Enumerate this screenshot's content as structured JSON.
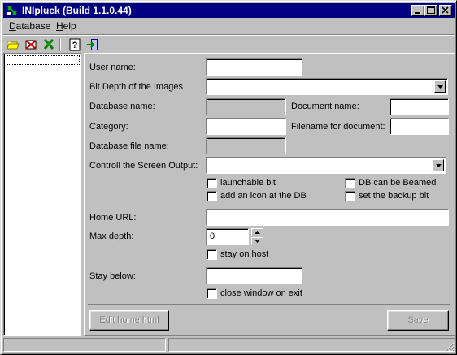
{
  "window": {
    "title": "INIpluck (Build 1.1.0.44)",
    "buttons": [
      "minimize-icon",
      "maximize-icon",
      "close-icon"
    ],
    "colors": {
      "titlebar": "#000080",
      "face": "#c0c0c0",
      "field": "#ffffff"
    }
  },
  "menu": {
    "items": [
      {
        "label": "Database",
        "mnemonic": "D",
        "rest": "atabase"
      },
      {
        "label": "Help",
        "mnemonic": "H",
        "rest": "elp"
      }
    ]
  },
  "toolbar": {
    "icons": [
      "open-folder-icon",
      "delete-database-icon",
      "pluck-icon",
      "help-icon",
      "exit-icon"
    ]
  },
  "form": {
    "user_name": {
      "label": "User name:",
      "value": ""
    },
    "bit_depth": {
      "label": "Bit Depth of the Images",
      "value": ""
    },
    "database_name": {
      "label": "Database name:",
      "value": ""
    },
    "document_name": {
      "label": "Document name:",
      "value": ""
    },
    "category": {
      "label": "Category:",
      "value": ""
    },
    "filename_for_document": {
      "label": "Filename for document:",
      "value": ""
    },
    "database_file_name": {
      "label": "Database file name:",
      "value": ""
    },
    "screen_output": {
      "label": "Controll the Screen Output:",
      "value": ""
    },
    "checkboxes": {
      "launchable_bit": {
        "label": "launchable bit",
        "checked": false
      },
      "db_can_be_beamed": {
        "label": "DB can be Beamed",
        "checked": false
      },
      "add_icon": {
        "label": "add an icon at the DB",
        "checked": false
      },
      "backup_bit": {
        "label": "set the backup bit",
        "checked": false
      },
      "stay_on_host": {
        "label": "stay on host",
        "checked": false
      },
      "close_window": {
        "label": "close window on exit",
        "checked": false
      }
    },
    "home_url": {
      "label": "Home URL:",
      "value": ""
    },
    "max_depth": {
      "label": "Max depth:",
      "value": "0"
    },
    "stay_below": {
      "label": "Stay below:",
      "value": ""
    }
  },
  "buttons": {
    "edit_home": "Edit home.html",
    "save": "Save"
  }
}
